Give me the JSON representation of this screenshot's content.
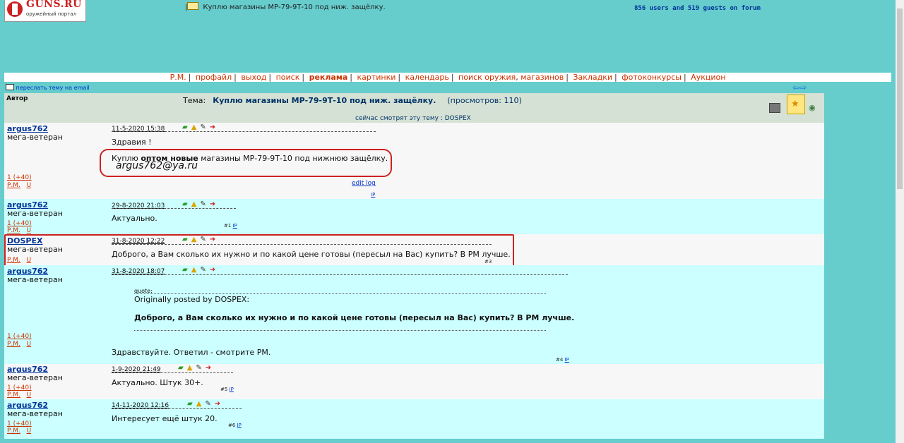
{
  "logo": {
    "name": "GUNS.RU",
    "subtitle": "оружейный портал"
  },
  "topic_breadcrumb": "Куплю магазины МР-79-9Т-10 под ниж. защёлку.",
  "online": "856 users and 519 guests on forum",
  "nav": {
    "items": [
      "Р.М.",
      "профайл",
      "выход",
      "поиск",
      "реклама",
      "картинки",
      "календарь",
      "поиск оружия",
      "магазинов",
      "Закладки",
      "фотоконкурсы",
      "Аукцион"
    ]
  },
  "forward_link": "переслать тему на email",
  "thread_header": {
    "author_label": "Автор",
    "topic_label": "Тема:",
    "topic_title": "Куплю магазины МР-79-9Т-10 под ниж. защёлку.",
    "views": "(просмотров: 110)",
    "watching": "сейчас смотрят эту тему : DOSPEX"
  },
  "posts": [
    {
      "author": "argus762",
      "rank": "мега-ветеран",
      "date": "11-5-2020 15:38",
      "rep": "1 (+40)",
      "pm": "Р.М.",
      "u": "U",
      "greeting": "Здравия !",
      "text_pre": "Куплю ",
      "text_bold": "оптом новые",
      "text_post": " магазины МР-79-9Т-10 под нижнюю защёлку.",
      "handwritten_email": "argus762@ya.ru",
      "edit_log": "edit log",
      "ip": "IP"
    },
    {
      "author": "argus762",
      "rank": "мега-ветеран",
      "date": "29-8-2020 21:03",
      "rep": "1 (+40)",
      "pm": "Р.М.",
      "u": "U",
      "text": "Актуально.",
      "num": "#1",
      "ip": "IP"
    },
    {
      "author": "DOSPEX",
      "rank": "мега-ветеран",
      "date": "31-8-2020 12:22",
      "pm": "Р.М.",
      "u": "U",
      "text": "Доброго, а Вам сколько их нужно и по какой цене готовы (пересыл на Вас) купить? В РМ лучше.",
      "num": "#3"
    },
    {
      "author": "argus762",
      "rank": "мега-ветеран",
      "date": "31-8-2020 18:07",
      "rep": "1 (+40)",
      "pm": "Р.М.",
      "u": "U",
      "quote_label": "quote:",
      "quote_origin": "Originally posted by DOSPEX:",
      "quote_text": "Доброго, а Вам сколько их нужно и по какой цене готовы (пересыл на Вас) купить? В РМ лучше.",
      "text": "Здравствуйте. Ответил - смотрите РМ.",
      "num": "#4",
      "ip": "IP"
    },
    {
      "author": "argus762",
      "rank": "мега-ветеран",
      "date": "1-9-2020 21:49",
      "rep": "1 (+40)",
      "pm": "Р.М.",
      "u": "U",
      "text": "Актуально. Штук 30+.",
      "num": "#5",
      "ip": "IP"
    },
    {
      "author": "argus762",
      "rank": "мега-ветеран",
      "date": "14-11-2020 12:16",
      "rep": "1 (+40)",
      "pm": "Р.М.",
      "u": "U",
      "text": "Интересует ещё штук 20.",
      "num": "#6",
      "ip": "IP"
    }
  ]
}
